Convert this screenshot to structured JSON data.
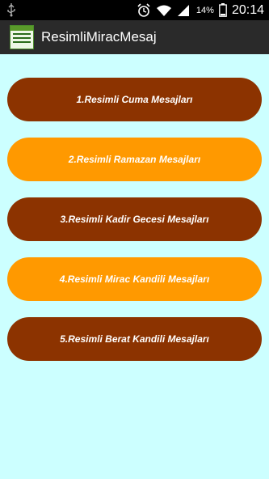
{
  "status_bar": {
    "left_icon": "usb-icon",
    "icons": [
      "alarm-icon",
      "wifi-icon",
      "signal-icon",
      "battery-icon"
    ],
    "battery_percent": "14%",
    "time": "20:14"
  },
  "action_bar": {
    "app_icon": "app-logo-icon",
    "title": "ResimliMiracMesaj"
  },
  "menu": {
    "items": [
      {
        "label": "1.Resimli Cuma Mesajları",
        "color": "#8c3300"
      },
      {
        "label": "2.Resimli Ramazan Mesajları",
        "color": "#ff9900"
      },
      {
        "label": "3.Resimli Kadir Gecesi Mesajları",
        "color": "#8c3300"
      },
      {
        "label": "4.Resimli Mirac Kandili Mesajları",
        "color": "#ff9900"
      },
      {
        "label": "5.Resimli Berat Kandili Mesajları",
        "color": "#8c3300"
      }
    ]
  },
  "colors": {
    "background": "#ccffff",
    "status_bar": "#000000",
    "action_bar": "#2a2a2a",
    "button_text": "#ffffff"
  }
}
